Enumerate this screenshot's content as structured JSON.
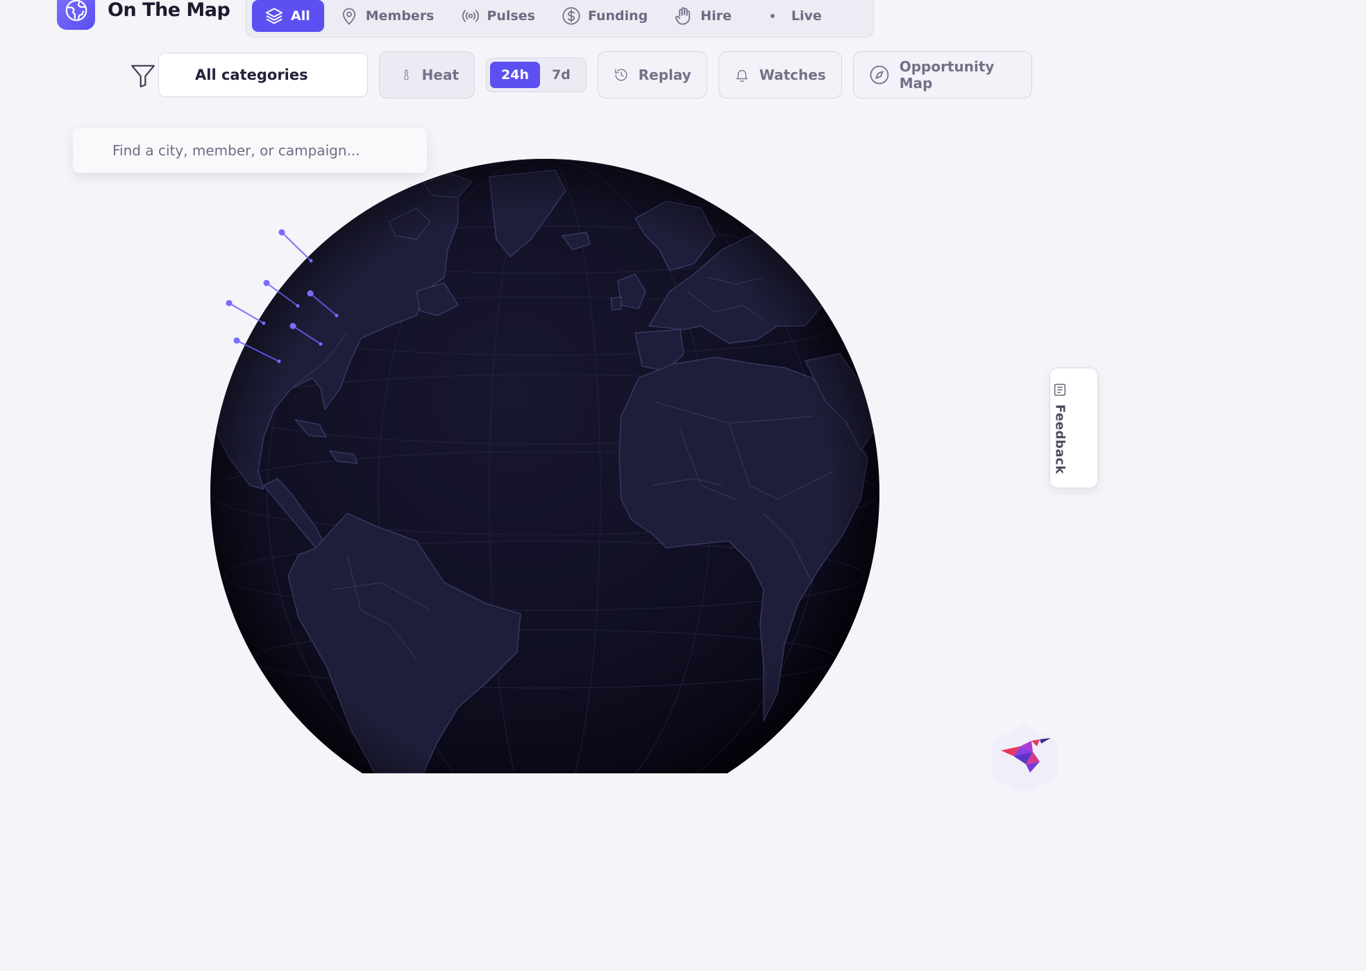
{
  "app": {
    "title": "On The Map",
    "logo_icon": "globe-icon",
    "accent_color": "#5c50f2"
  },
  "layers": {
    "tabs": [
      {
        "label": "All",
        "icon": "layers-icon",
        "active": true
      },
      {
        "label": "Members",
        "icon": "map-pin-icon",
        "active": false
      },
      {
        "label": "Pulses",
        "icon": "broadcast-icon",
        "active": false
      },
      {
        "label": "Funding",
        "icon": "dollar-circle-icon",
        "active": false
      },
      {
        "label": "Hire",
        "icon": "hand-icon",
        "active": false
      },
      {
        "label": "Live",
        "icon": "live-dot-icon",
        "active": false
      }
    ]
  },
  "toolbar": {
    "category_value": "All categories",
    "heat_label": "Heat",
    "ranges": [
      {
        "label": "24h",
        "active": true
      },
      {
        "label": "7d",
        "active": false
      }
    ],
    "replay_label": "Replay",
    "watches_label": "Watches",
    "opportunity_label": "Opportunity Map"
  },
  "search": {
    "placeholder": "Find a city, member, or campaign..."
  },
  "globe": {
    "ocean_color": "#0e0d1f",
    "land_color": "#1d1c36",
    "border_color": "#3d3a66",
    "marker_color": "#6b5cf5"
  },
  "feedback": {
    "label": "Feedback"
  }
}
